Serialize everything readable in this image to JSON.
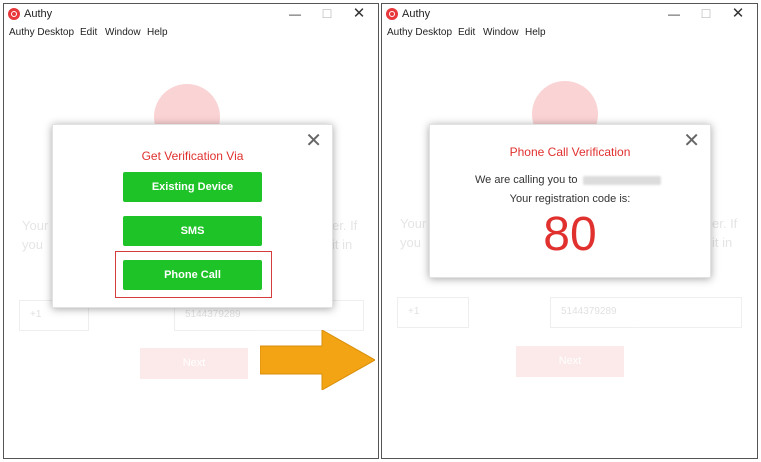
{
  "left_window": {
    "title": "Authy",
    "controls": {
      "minimize": "—",
      "maximize": "☐",
      "close": "✕"
    },
    "menu": [
      "Authy Desktop",
      "Edit",
      "Window",
      "Help"
    ],
    "background": {
      "text_left": [
        "Your",
        "you"
      ],
      "text_right": [
        "er. If",
        "it in"
      ],
      "country_code": "+1",
      "phone": "5144379289",
      "next": "Next"
    },
    "dialog": {
      "close": "✕",
      "title": "Get Verification Via",
      "options": [
        "Existing Device",
        "SMS",
        "Phone Call"
      ],
      "highlighted": "Phone Call"
    }
  },
  "right_window": {
    "title": "Authy",
    "controls": {
      "minimize": "—",
      "maximize": "☐",
      "close": "✕"
    },
    "menu": [
      "Authy Desktop",
      "Edit",
      "Window",
      "Help"
    ],
    "background": {
      "text_left": [
        "Your",
        "you"
      ],
      "text_right": [
        "er. If",
        "it in"
      ],
      "country_code": "+1",
      "phone": "5144379289",
      "next": "Next"
    },
    "dialog": {
      "close": "✕",
      "title": "Phone Call Verification",
      "calling_text": "We are calling you to",
      "registration_text": "Your registration code is:",
      "code": "80"
    }
  },
  "colors": {
    "brand_red": "#e0312f",
    "button_green": "#1ec327",
    "arrow_orange": "#f2a414",
    "highlight_border": "#d63c3c"
  },
  "icons": {
    "app": "authy-logo-icon",
    "arrow": "right-arrow-icon"
  }
}
